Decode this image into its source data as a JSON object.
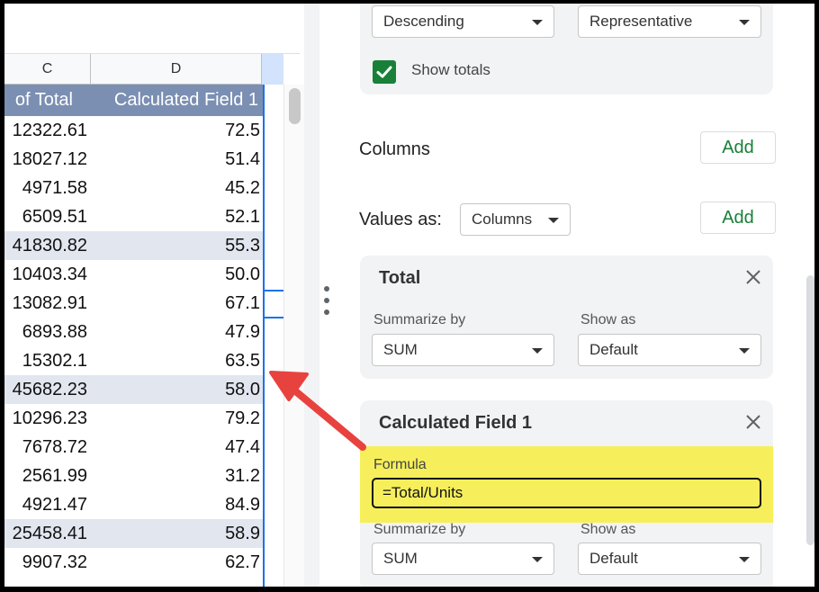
{
  "sheet": {
    "column_headers": [
      "C",
      "D"
    ],
    "pivot_header": {
      "col_c": "of Total",
      "col_d": "Calculated Field 1"
    },
    "rows": [
      {
        "c": "12322.61",
        "d": "72.5",
        "shaded": false
      },
      {
        "c": "18027.12",
        "d": "51.4",
        "shaded": false
      },
      {
        "c": "4971.58",
        "d": "45.2",
        "shaded": false
      },
      {
        "c": "6509.51",
        "d": "52.1",
        "shaded": false
      },
      {
        "c": "41830.82",
        "d": "55.3",
        "shaded": true
      },
      {
        "c": "10403.34",
        "d": "50.0",
        "shaded": false
      },
      {
        "c": "13082.91",
        "d": "67.1",
        "shaded": false
      },
      {
        "c": "6893.88",
        "d": "47.9",
        "shaded": false
      },
      {
        "c": "15302.1",
        "d": "63.5",
        "shaded": false
      },
      {
        "c": "45682.23",
        "d": "58.0",
        "shaded": true
      },
      {
        "c": "10296.23",
        "d": "79.2",
        "shaded": false
      },
      {
        "c": "7678.72",
        "d": "47.4",
        "shaded": false
      },
      {
        "c": "2561.99",
        "d": "31.2",
        "shaded": false
      },
      {
        "c": "4921.47",
        "d": "84.9",
        "shaded": false
      },
      {
        "c": "25458.41",
        "d": "58.9",
        "shaded": true
      },
      {
        "c": "9907.32",
        "d": "62.7",
        "shaded": false
      }
    ]
  },
  "editor": {
    "rows_card": {
      "order_value": "Descending",
      "sortby_value": "Representative",
      "show_totals_label": "Show totals",
      "show_totals_checked": true
    },
    "columns_label": "Columns",
    "add_label": "Add",
    "values_as_label": "Values as:",
    "values_as_value": "Columns",
    "total_card": {
      "title": "Total",
      "summarize_label": "Summarize by",
      "summarize_value": "SUM",
      "show_as_label": "Show as",
      "show_as_value": "Default"
    },
    "calc_card": {
      "title": "Calculated Field 1",
      "formula_label": "Formula",
      "formula_value": "=Total/Units",
      "summarize_label": "Summarize by",
      "summarize_value": "SUM",
      "show_as_label": "Show as",
      "show_as_value": "Default"
    }
  },
  "colors": {
    "pivot_header": "#7b8fb3",
    "row_shade": "#e1e6ef",
    "add_button_text": "#188038",
    "checkbox": "#188038",
    "highlight": "#f6ef5b",
    "arrow": "#e8423f",
    "selection": "#1a73e8"
  },
  "icons": [
    "check-icon",
    "close-icon",
    "chevron-down-icon",
    "more-vert-icon",
    "arrow-annotation"
  ]
}
